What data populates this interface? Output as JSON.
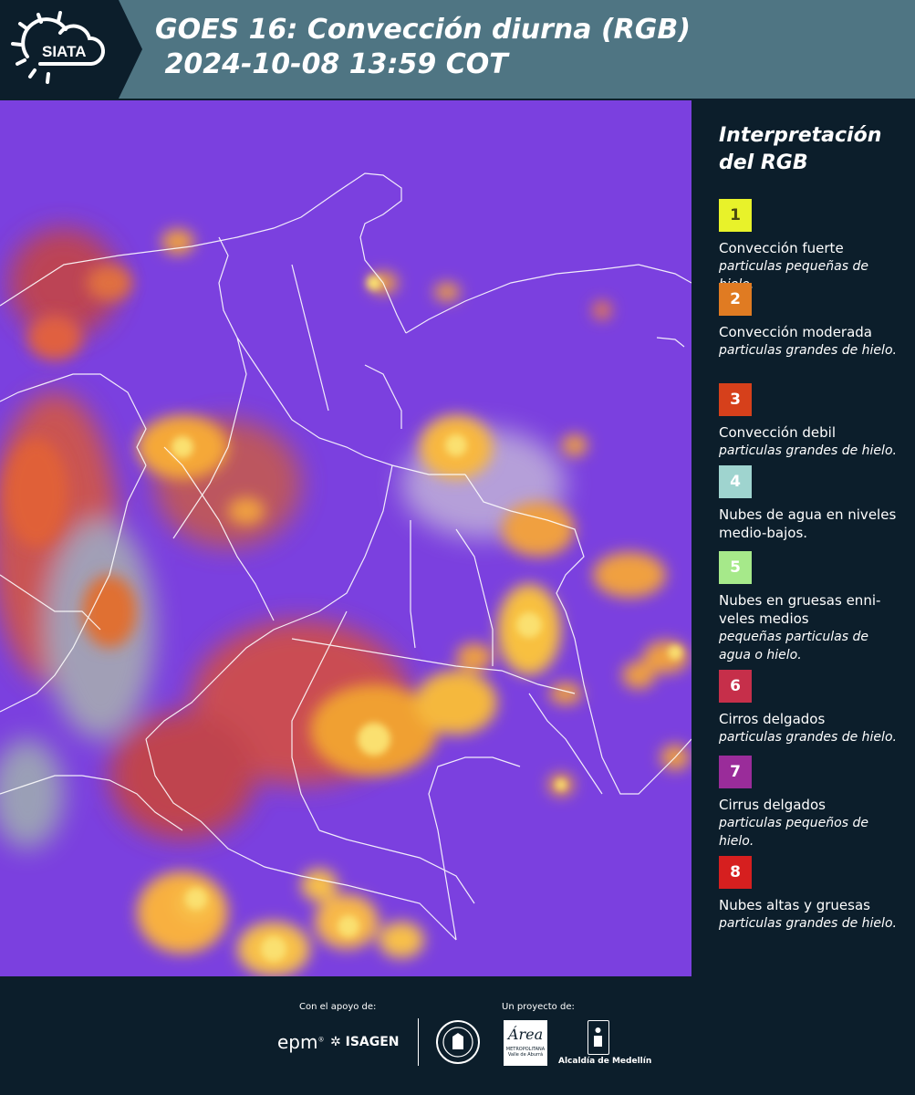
{
  "header": {
    "logo_text": "SIATA",
    "title_line1": "GOES 16: Convección diurna (RGB)",
    "title_line2": " 2024-10-08 13:59 COT"
  },
  "legend": {
    "title_line1": "Interpretación",
    "title_line2": "del RGB",
    "items": [
      {
        "num": "1",
        "color": "#e8f22a",
        "text_color": "#4a4a10",
        "name": "Convección fuerte",
        "desc": "particulas pequeñas de hielo."
      },
      {
        "num": "2",
        "color": "#e07b22",
        "text_color": "#ffffff",
        "name": "Convección moderada",
        "desc": "particulas grandes de hielo."
      },
      {
        "num": "3",
        "color": "#d6401b",
        "text_color": "#ffffff",
        "name": "Convección debil",
        "desc": "particulas grandes de hielo."
      },
      {
        "num": "4",
        "color": "#9fd4cf",
        "text_color": "#ffffff",
        "name": "Nubes de agua en niveles medio-bajos.",
        "desc": ""
      },
      {
        "num": "5",
        "color": "#a6e98a",
        "text_color": "#ffffff",
        "name": "Nubes en gruesas enni- veles medios",
        "desc": "pequeñas particulas de agua o hielo."
      },
      {
        "num": "6",
        "color": "#c62f4a",
        "text_color": "#ffffff",
        "name": "Cirros delgados",
        "desc": "particulas grandes de hielo."
      },
      {
        "num": "7",
        "color": "#9a2c9a",
        "text_color": "#ffffff",
        "name": "Cirrus delgados",
        "desc": "particulas pequeños de hielo."
      },
      {
        "num": "8",
        "color": "#d61f1f",
        "text_color": "#ffffff",
        "name": "Nubes altas y gruesas",
        "desc": "particulas grandes de hielo."
      }
    ]
  },
  "footer": {
    "support_label": "Con el apoyo de:",
    "project_label": "Un proyecto de:",
    "sponsor1": "epm",
    "sponsor2": "ISAGEN",
    "area_logo_text": "Área",
    "area_caption": "METROPOLITANA",
    "area_subcaption": "Valle de Aburrá",
    "alcaldia": "Alcaldía de Medellín"
  }
}
